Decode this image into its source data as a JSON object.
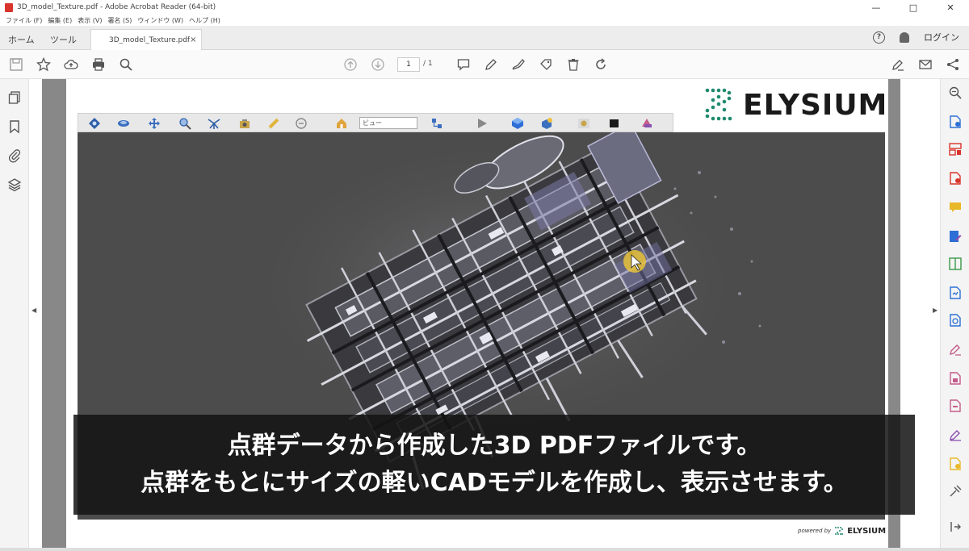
{
  "window": {
    "title": "3D_model_Texture.pdf - Adobe Acrobat Reader (64-bit)",
    "controls": [
      "—",
      "□",
      "✕"
    ]
  },
  "menu": [
    "ファイル (F)",
    "編集 (E)",
    "表示 (V)",
    "署名 (S)",
    "ウィンドウ (W)",
    "ヘルプ (H)"
  ],
  "tabs": {
    "home": "ホーム",
    "tools": "ツール",
    "document": "3D_model_Texture.pdf",
    "close": "×"
  },
  "header_right": {
    "help": "?",
    "login": "ログイン"
  },
  "toolbar": {
    "page_current": "1",
    "page_total": "/ 1"
  },
  "viewer3d": {
    "view_select": "ビュー"
  },
  "brand": {
    "logo_text": "ELYSIUM",
    "powered_by": "powered by",
    "powered_logo": "ELYSIUM"
  },
  "subtitle": {
    "line1": "点群データから作成した3D PDFファイルです。",
    "line2": "点群をもとにサイズの軽いCADモデルを作成し、表示させます。"
  },
  "colors": {
    "acrobat_red": "#d9342b",
    "brand_green": "#1f8a6e",
    "viewport_bg": "#4c4c4c"
  }
}
